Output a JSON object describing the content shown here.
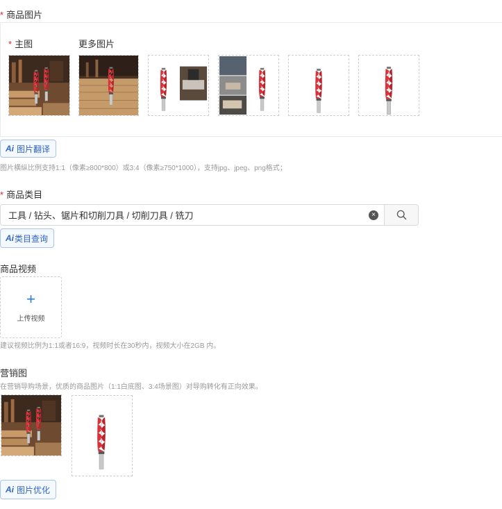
{
  "product_images": {
    "title": "商品图片",
    "main_label": "主图",
    "more_label": "更多图片",
    "images": [
      {
        "kind": "scene-workshop-router"
      },
      {
        "kind": "scene-wood-board-router"
      },
      {
        "kind": "bit-with-closeup"
      },
      {
        "kind": "collage-usage"
      },
      {
        "kind": "bit-white"
      },
      {
        "kind": "bit-white"
      }
    ],
    "translate_button": "图片翻译",
    "hint": "图片横纵比例支持1:1（像素≥800*800）或3:4（像素≥750*1000），支持jpg、jpeg、png格式；"
  },
  "category": {
    "title": "商品类目",
    "value": "工具 / 钻头、锯片和切削刀具 / 切削刀具 / 铣刀",
    "query_button": "类目查询"
  },
  "video": {
    "title": "商品视频",
    "upload_label": "上传视频",
    "hint": "建议视频比例为1:1或者16:9，视频时长在30秒内，视频大小在2GB 内。"
  },
  "marketing": {
    "title": "营销图",
    "hint": "在营销导购场景，优质的商品图片（1:1白底图、3:4场景图）对导购转化有正向效果。",
    "optimize_button": "图片优化"
  },
  "icons": {
    "ai": "Ai",
    "clear": "×",
    "plus": "+"
  },
  "colors": {
    "required": "#e0262f",
    "accent": "#2f63c9",
    "bit_red": "#d9323a"
  }
}
